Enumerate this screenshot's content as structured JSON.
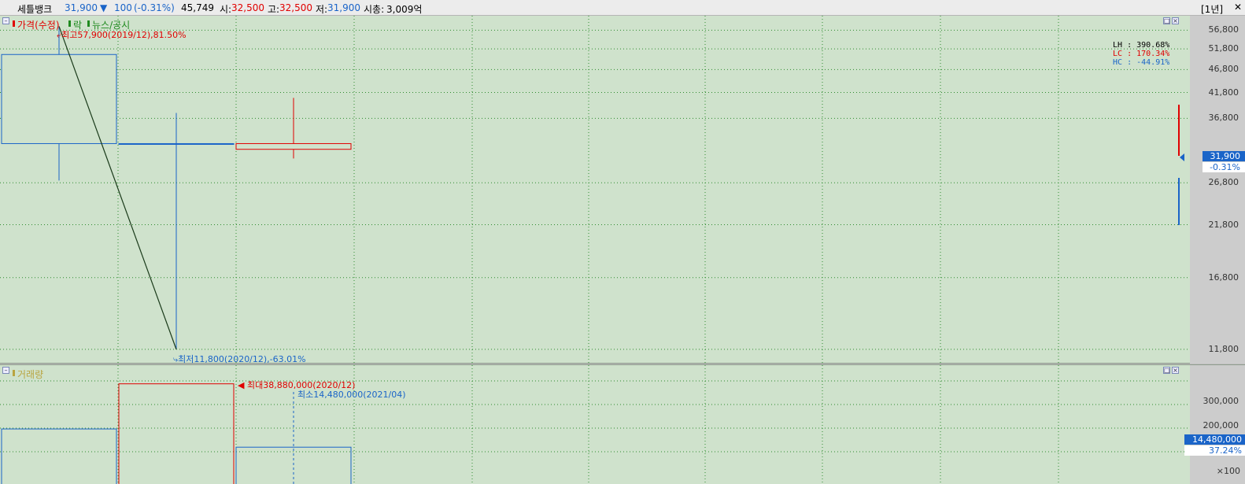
{
  "header": {
    "stock_name": "세틀뱅크",
    "price": "31,900",
    "change_arrow": "▼",
    "change": "100",
    "change_pct": "(-0.31%)",
    "volume": "45,749",
    "open_label": "시:",
    "open": "32,500",
    "high_label": "고:",
    "high": "32,500",
    "low_label": "저:",
    "low": "31,900",
    "marketcap_label": "시총:",
    "marketcap": "3,009억",
    "period_label": "[1년]",
    "close_icon": "close-icon"
  },
  "price_pane": {
    "legend": [
      "가격(수정)",
      "락",
      "뉴스/공시"
    ],
    "max_annotation": "최고57,900(2019/12),81.50%",
    "min_annotation": "최저11,800(2020/12),-63.01%",
    "stats": [
      {
        "label": "LH",
        "value": "390.68%",
        "color": "#000000"
      },
      {
        "label": "LC",
        "value": "170.34%",
        "color": "#e00000"
      },
      {
        "label": "HC",
        "value": "-44.91%",
        "color": "#1a64c8"
      }
    ],
    "current_price_badge": "31,900",
    "current_change_badge": "-0.31%"
  },
  "volume_pane": {
    "legend": "거래량",
    "max_annotation": "최대38,880,000(2020/12)",
    "min_annotation": "최소14,480,000(2021/04)",
    "current_volume_badge": "14,480,000",
    "current_ratio_badge": "37.24%",
    "unit_label": "×100"
  },
  "colors": {
    "up": "#e00000",
    "down": "#1a64c8",
    "background": "#cfe2cc",
    "grid": "#2e8b2e"
  },
  "chart_data": [
    {
      "type": "candlestick",
      "title": "가격(수정)",
      "categories": [
        "2019/12",
        "2020/12",
        "2021/04"
      ],
      "series": [
        {
          "name": "가격(수정)",
          "open": [
            50400,
            32500,
            31600
          ],
          "high": [
            57900,
            37800,
            40700
          ],
          "low": [
            27100,
            11800,
            30200
          ],
          "close": [
            32500,
            32500,
            32500
          ]
        }
      ],
      "y_ticks": [
        11800,
        16800,
        21800,
        26800,
        36800,
        41800,
        46800,
        51800,
        56800
      ],
      "y_tick_labels": [
        "11,800",
        "16,800",
        "21,800",
        "26,800",
        "36,800",
        "41,800",
        "46,800",
        "51,800",
        "56,800"
      ],
      "ylim": [
        11000,
        61000
      ],
      "y_scale": "log",
      "grid": true
    },
    {
      "type": "bar",
      "title": "거래량",
      "categories": [
        "2019/12",
        "2020/12",
        "2021/04"
      ],
      "series": [
        {
          "name": "거래량",
          "values": [
            21500000,
            38880000,
            14480000
          ]
        }
      ],
      "y_ticks": [
        200000,
        300000
      ],
      "y_tick_labels": [
        "200,000",
        "300,000"
      ],
      "y_unit": "×100",
      "grid": true
    }
  ]
}
